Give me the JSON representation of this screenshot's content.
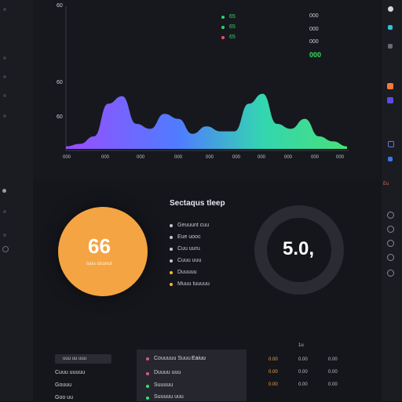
{
  "chart": {
    "y_ticks": [
      "60",
      "60",
      "60"
    ],
    "x_ticks": [
      "000",
      "000",
      "000",
      "000",
      "000",
      "000",
      "000",
      "000",
      "000",
      "000"
    ],
    "legend": [
      {
        "label": "65",
        "color": "#34d16a"
      },
      {
        "label": "65",
        "color": "#34d16a"
      },
      {
        "label": "65",
        "color": "#e05a5a"
      }
    ],
    "stats": [
      "000",
      "000",
      "000"
    ],
    "highlight": "000",
    "highlight_color": "#3ddc5c"
  },
  "chart_data": {
    "type": "area",
    "x": [
      0,
      1,
      2,
      3,
      4,
      5,
      6,
      7,
      8,
      9,
      10,
      11,
      12,
      13,
      14,
      15,
      16,
      17,
      18,
      19,
      20
    ],
    "values": [
      2,
      4,
      10,
      36,
      42,
      20,
      16,
      28,
      24,
      12,
      18,
      14,
      14,
      36,
      44,
      20,
      16,
      24,
      10,
      6,
      2
    ],
    "ylim": [
      0,
      50
    ],
    "colors": [
      "#9a4dff",
      "#4f7cff",
      "#33d6b0",
      "#48e07a"
    ]
  },
  "section_title": "Sectaqus tleep",
  "orange_gauge": {
    "value": "66",
    "label": "tuuu cicunut",
    "color": "#f4a442"
  },
  "ring_gauge": {
    "value": "5.0,"
  },
  "gauge_legend": [
    {
      "label": "Geuuunt cuu",
      "color": "#c5c6cf"
    },
    {
      "label": "Eue uooc",
      "color": "#c5c6cf"
    },
    {
      "label": "Cuu uuru",
      "color": "#c5c6cf"
    },
    {
      "label": "Cuuu uuu",
      "color": "#c5c6cf"
    },
    {
      "label": "Duuuuu",
      "color": "#f4b63d"
    },
    {
      "label": "Muuu tuuuuu",
      "color": "#f4b63d"
    }
  ],
  "bottom_left": {
    "tag": "uuu uu uuu",
    "rows": [
      "Cuuu uuuuu",
      "Gouuu",
      "Goo uu"
    ]
  },
  "bottom_table": {
    "header_label": "Couuuuu Suuu",
    "header_value": "Eaiuu",
    "rows": [
      {
        "label": "Duuuu uuu",
        "color": "#e0567a"
      },
      {
        "label": "Suuuuu",
        "color": "#3ddc6b"
      },
      {
        "label": "Suuuuu uuu",
        "color": "#3ddc6b"
      }
    ]
  },
  "bottom_right": {
    "header": "1u",
    "cols": [
      [
        "0.00",
        "0.00",
        "0.00"
      ],
      [
        "0.00",
        "0.00",
        "0.00"
      ],
      [
        "0.00",
        "0.00",
        "0.00"
      ]
    ]
  },
  "right_label": "Eu"
}
